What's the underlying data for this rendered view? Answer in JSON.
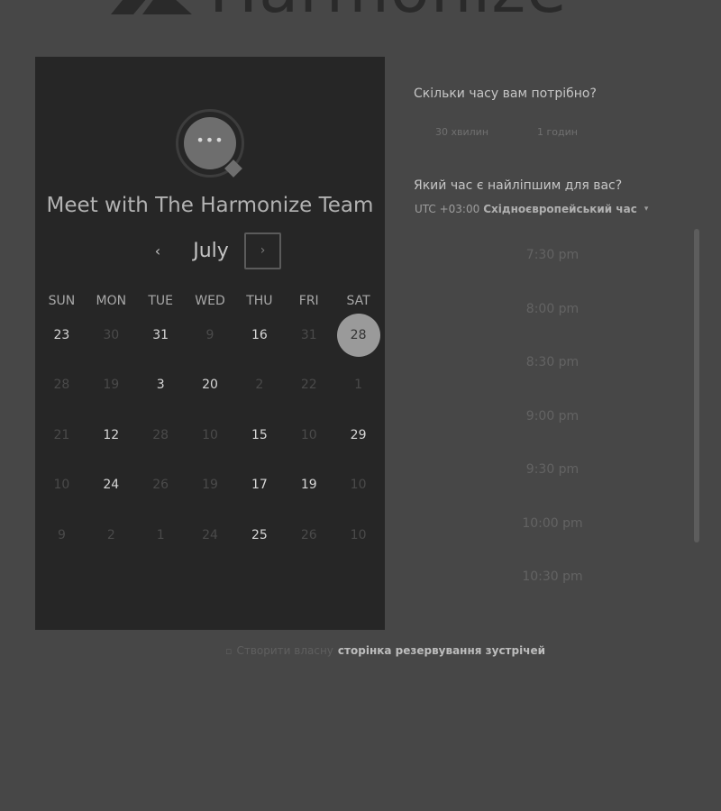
{
  "brand": {
    "logo_text": "Harmonize"
  },
  "panel": {
    "title": "Meet with The Harmonize Team",
    "avatar_icon": "chat-bubble-icon",
    "month": "July",
    "prev_icon": "‹",
    "next_icon": "›",
    "weekdays": [
      "SUN",
      "MON",
      "TUE",
      "WED",
      "THU",
      "FRI",
      "SAT"
    ],
    "weeks": [
      [
        {
          "d": "23",
          "on": true
        },
        {
          "d": "30",
          "on": false
        },
        {
          "d": "31",
          "on": true
        },
        {
          "d": "9",
          "on": false
        },
        {
          "d": "16",
          "on": true
        },
        {
          "d": "31",
          "on": false
        },
        {
          "d": "28",
          "on": true,
          "sel": true
        }
      ],
      [
        {
          "d": "28",
          "on": false
        },
        {
          "d": "19",
          "on": false
        },
        {
          "d": "3",
          "on": true
        },
        {
          "d": "20",
          "on": true
        },
        {
          "d": "2",
          "on": false
        },
        {
          "d": "22",
          "on": false
        },
        {
          "d": "1",
          "on": false
        }
      ],
      [
        {
          "d": "21",
          "on": false
        },
        {
          "d": "12",
          "on": true
        },
        {
          "d": "28",
          "on": false
        },
        {
          "d": "10",
          "on": false
        },
        {
          "d": "15",
          "on": true
        },
        {
          "d": "10",
          "on": false
        },
        {
          "d": "29",
          "on": true
        }
      ],
      [
        {
          "d": "10",
          "on": false
        },
        {
          "d": "24",
          "on": true
        },
        {
          "d": "26",
          "on": false
        },
        {
          "d": "19",
          "on": false
        },
        {
          "d": "17",
          "on": true
        },
        {
          "d": "19",
          "on": true
        },
        {
          "d": "10",
          "on": false
        }
      ],
      [
        {
          "d": "9",
          "on": false
        },
        {
          "d": "2",
          "on": false
        },
        {
          "d": "1",
          "on": false
        },
        {
          "d": "24",
          "on": false
        },
        {
          "d": "25",
          "on": true
        },
        {
          "d": "26",
          "on": false
        },
        {
          "d": "10",
          "on": false
        }
      ]
    ]
  },
  "duration": {
    "question": "Скільки часу вам потрібно?",
    "options": [
      "30 хвилин",
      "1 годин"
    ]
  },
  "time": {
    "question": "Який час є найліпшим для вас?",
    "tz_offset": "UTC +03:00",
    "tz_name": "Східноєвропейський час",
    "tz_caret": "▾",
    "slots": [
      "7:30 pm",
      "8:00 pm",
      "8:30 pm",
      "9:00 pm",
      "9:30 pm",
      "10:00 pm",
      "10:30 pm"
    ]
  },
  "footer": {
    "icon": "calendar-icon",
    "prefix": "Створити власну",
    "link": "сторінка резервування зустрічей"
  }
}
